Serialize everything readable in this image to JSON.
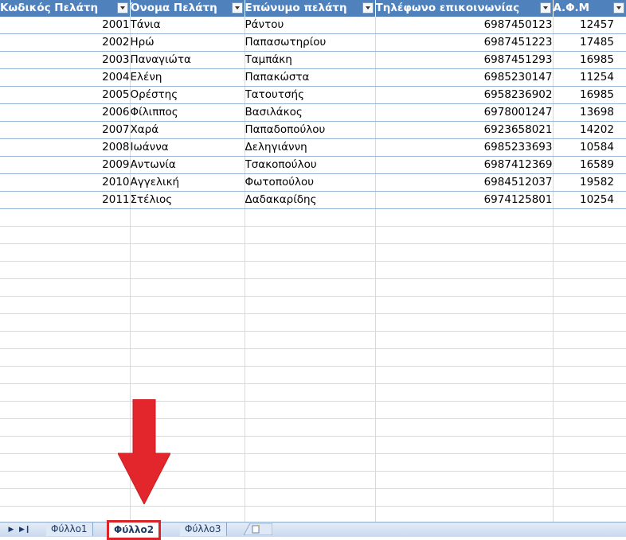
{
  "headers": [
    "Κωδικός Πελάτη",
    "Όνομα Πελάτη",
    "Επώνυμο πελάτη",
    "Τηλέφωνο επικοινωνίας",
    "Α.Φ.Μ"
  ],
  "rows": [
    [
      "2001",
      "Τάνια",
      "Ράντου",
      "6987450123",
      "12457"
    ],
    [
      "2002",
      "Ηρώ",
      "Παπασωτηρίου",
      "6987451223",
      "17485"
    ],
    [
      "2003",
      "Παναγιώτα",
      "Ταμπάκη",
      "6987451293",
      "16985"
    ],
    [
      "2004",
      "Ελένη",
      "Παπακώστα",
      "6985230147",
      "11254"
    ],
    [
      "2005",
      "Ορέστης",
      "Τατουτσής",
      "6958236902",
      "16985"
    ],
    [
      "2006",
      "Φίλιππος",
      "Βασιλάκος",
      "6978001247",
      "13698"
    ],
    [
      "2007",
      "Χαρά",
      "Παπαδοπούλου",
      "6923658021",
      "14202"
    ],
    [
      "2008",
      "Ιωάννα",
      "Δεληγιάννη",
      "6985233693",
      "10584"
    ],
    [
      "2009",
      "Αντωνία",
      "Τσακοπούλου",
      "6987412369",
      "16589"
    ],
    [
      "2010",
      "Αγγελική",
      "Φωτοπούλου",
      "6984512037",
      "19582"
    ],
    [
      "2011",
      "Στέλιος",
      "Δαδακαρίδης",
      "6974125801",
      "10254"
    ]
  ],
  "sheet_tabs": [
    "Φύλλο1",
    "Φύλλο2",
    "Φύλλο3"
  ],
  "active_tab": "Φύλλο2",
  "colors": {
    "header_bg": "#4f81bd",
    "row_border": "#95b3d7",
    "highlight": "#d9242a",
    "arrow": "#e3262b"
  },
  "icons": {
    "filter": "filter-dropdown-icon",
    "nav_next": "nav-next-icon",
    "nav_last": "nav-last-icon",
    "new_sheet": "insert-worksheet-icon",
    "annotation": "red-down-arrow-icon"
  }
}
